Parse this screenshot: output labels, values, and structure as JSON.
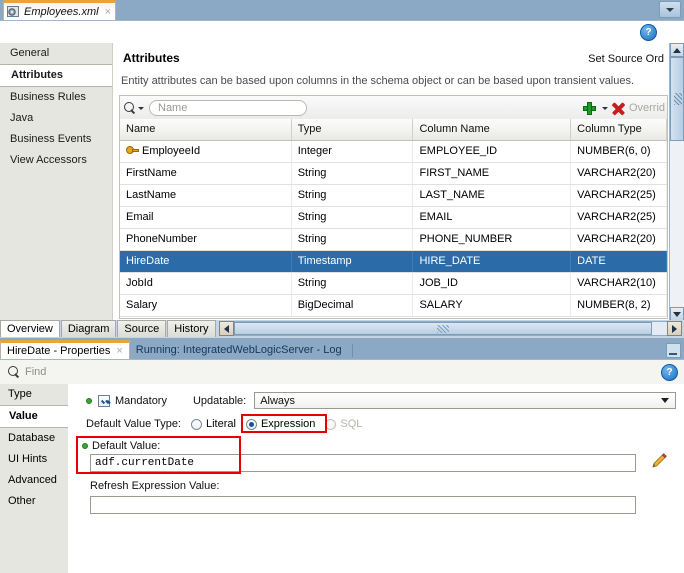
{
  "editor": {
    "document_tab": {
      "label": "Employees.xml",
      "icon": "xml-file-icon",
      "close": "×"
    },
    "minimize_icon": "chevron-down-icon",
    "help_icon": "help-question-icon",
    "left_tabs": [
      {
        "label": "General",
        "selected": false
      },
      {
        "label": "Attributes",
        "selected": true
      },
      {
        "label": "Business Rules",
        "selected": false
      },
      {
        "label": "Java",
        "selected": false
      },
      {
        "label": "Business Events",
        "selected": false
      },
      {
        "label": "View Accessors",
        "selected": false
      }
    ],
    "pane_title": "Attributes",
    "set_source_order": "Set Source Ord",
    "description": "Entity attributes can be based upon columns in the schema object or can be based upon transient values.",
    "toolbar": {
      "search_icon": "search-icon",
      "search_dropdown_icon": "caret-down-icon",
      "search_placeholder": "Name",
      "add_icon": "plus-icon",
      "add_dropdown_icon": "caret-down-icon",
      "delete_icon": "red-x-icon",
      "override_label": "Overrid"
    },
    "table": {
      "columns": [
        "Name",
        "Type",
        "Column Name",
        "Column Type"
      ],
      "rows": [
        {
          "name": "EmployeeId",
          "type": "Integer",
          "column_name": "EMPLOYEE_ID",
          "column_type": "NUMBER(6, 0)",
          "key": true,
          "selected": false
        },
        {
          "name": "FirstName",
          "type": "String",
          "column_name": "FIRST_NAME",
          "column_type": "VARCHAR2(20)",
          "key": false,
          "selected": false
        },
        {
          "name": "LastName",
          "type": "String",
          "column_name": "LAST_NAME",
          "column_type": "VARCHAR2(25)",
          "key": false,
          "selected": false
        },
        {
          "name": "Email",
          "type": "String",
          "column_name": "EMAIL",
          "column_type": "VARCHAR2(25)",
          "key": false,
          "selected": false
        },
        {
          "name": "PhoneNumber",
          "type": "String",
          "column_name": "PHONE_NUMBER",
          "column_type": "VARCHAR2(20)",
          "key": false,
          "selected": false
        },
        {
          "name": "HireDate",
          "type": "Timestamp",
          "column_name": "HIRE_DATE",
          "column_type": "DATE",
          "key": false,
          "selected": true
        },
        {
          "name": "JobId",
          "type": "String",
          "column_name": "JOB_ID",
          "column_type": "VARCHAR2(10)",
          "key": false,
          "selected": false
        },
        {
          "name": "Salary",
          "type": "BigDecimal",
          "column_name": "SALARY",
          "column_type": "NUMBER(8, 2)",
          "key": false,
          "selected": false
        }
      ]
    },
    "scrollbar": {
      "up_icon": "scroll-up-icon",
      "down_icon": "scroll-down-icon"
    },
    "bottom_tabs": [
      {
        "label": "Overview",
        "selected": true
      },
      {
        "label": "Diagram",
        "selected": false
      },
      {
        "label": "Source",
        "selected": false
      },
      {
        "label": "History",
        "selected": false
      }
    ],
    "hscroll": {
      "left_icon": "scroll-left-icon",
      "right_icon": "scroll-right-icon"
    }
  },
  "properties": {
    "tabs": [
      {
        "label": "HireDate - Properties",
        "selected": true,
        "close": "×"
      },
      {
        "label": "Running: IntegratedWebLogicServer - Log",
        "selected": false
      }
    ],
    "minimize_icon": "minimize-icon",
    "find": {
      "icon": "search-icon",
      "placeholder": "Find",
      "help_icon": "help-question-icon"
    },
    "left_tabs": [
      {
        "label": "Type",
        "selected": false
      },
      {
        "label": "Value",
        "selected": true
      },
      {
        "label": "Database",
        "selected": false
      },
      {
        "label": "UI Hints",
        "selected": false
      },
      {
        "label": "Advanced",
        "selected": false
      },
      {
        "label": "Other",
        "selected": false
      }
    ],
    "form": {
      "mandatory_label": "Mandatory",
      "mandatory_checked": true,
      "updatable_label": "Updatable:",
      "updatable_value": "Always",
      "updatable_arrow_icon": "caret-down-icon",
      "default_value_type_label": "Default Value Type:",
      "options": [
        {
          "label": "Literal",
          "selected": false,
          "disabled": false
        },
        {
          "label": "Expression",
          "selected": true,
          "disabled": false
        },
        {
          "label": "SQL",
          "selected": false,
          "disabled": true
        }
      ],
      "default_value_label": "Default Value:",
      "default_value": "adf.currentDate",
      "edit_icon": "pencil-icon",
      "refresh_expression_label": "Refresh Expression Value:",
      "refresh_expression_value": ""
    },
    "highlights": {
      "color": "#e60000"
    }
  }
}
